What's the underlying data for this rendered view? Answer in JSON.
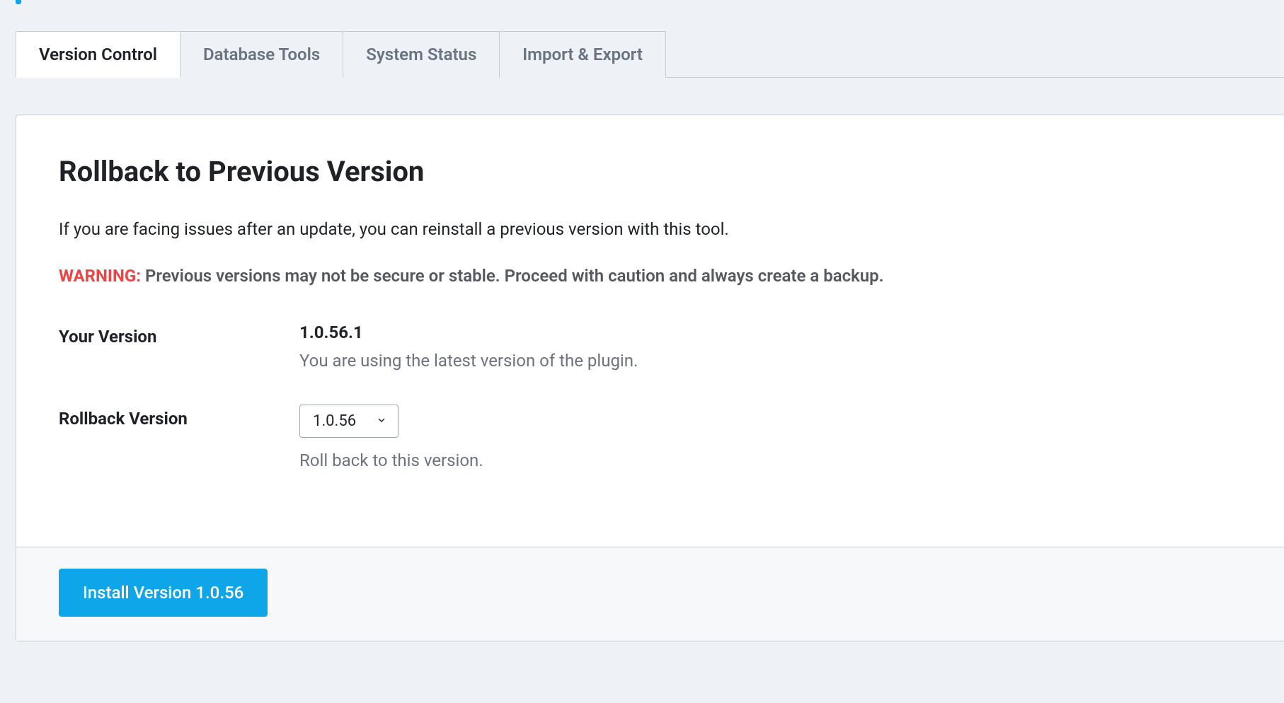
{
  "tabs": [
    {
      "label": "Version Control",
      "active": true
    },
    {
      "label": "Database Tools",
      "active": false
    },
    {
      "label": "System Status",
      "active": false
    },
    {
      "label": "Import & Export",
      "active": false
    }
  ],
  "panel": {
    "title": "Rollback to Previous Version",
    "description": "If you are facing issues after an update, you can reinstall a previous version with this tool.",
    "warning_label": "WARNING:",
    "warning_text": "Previous versions may not be secure or stable. Proceed with caution and always create a backup."
  },
  "your_version": {
    "label": "Your Version",
    "value": "1.0.56.1",
    "note": "You are using the latest version of the plugin."
  },
  "rollback_version": {
    "label": "Rollback Version",
    "selected": "1.0.56",
    "note": "Roll back to this version."
  },
  "install_button": {
    "label": "Install Version 1.0.56"
  }
}
